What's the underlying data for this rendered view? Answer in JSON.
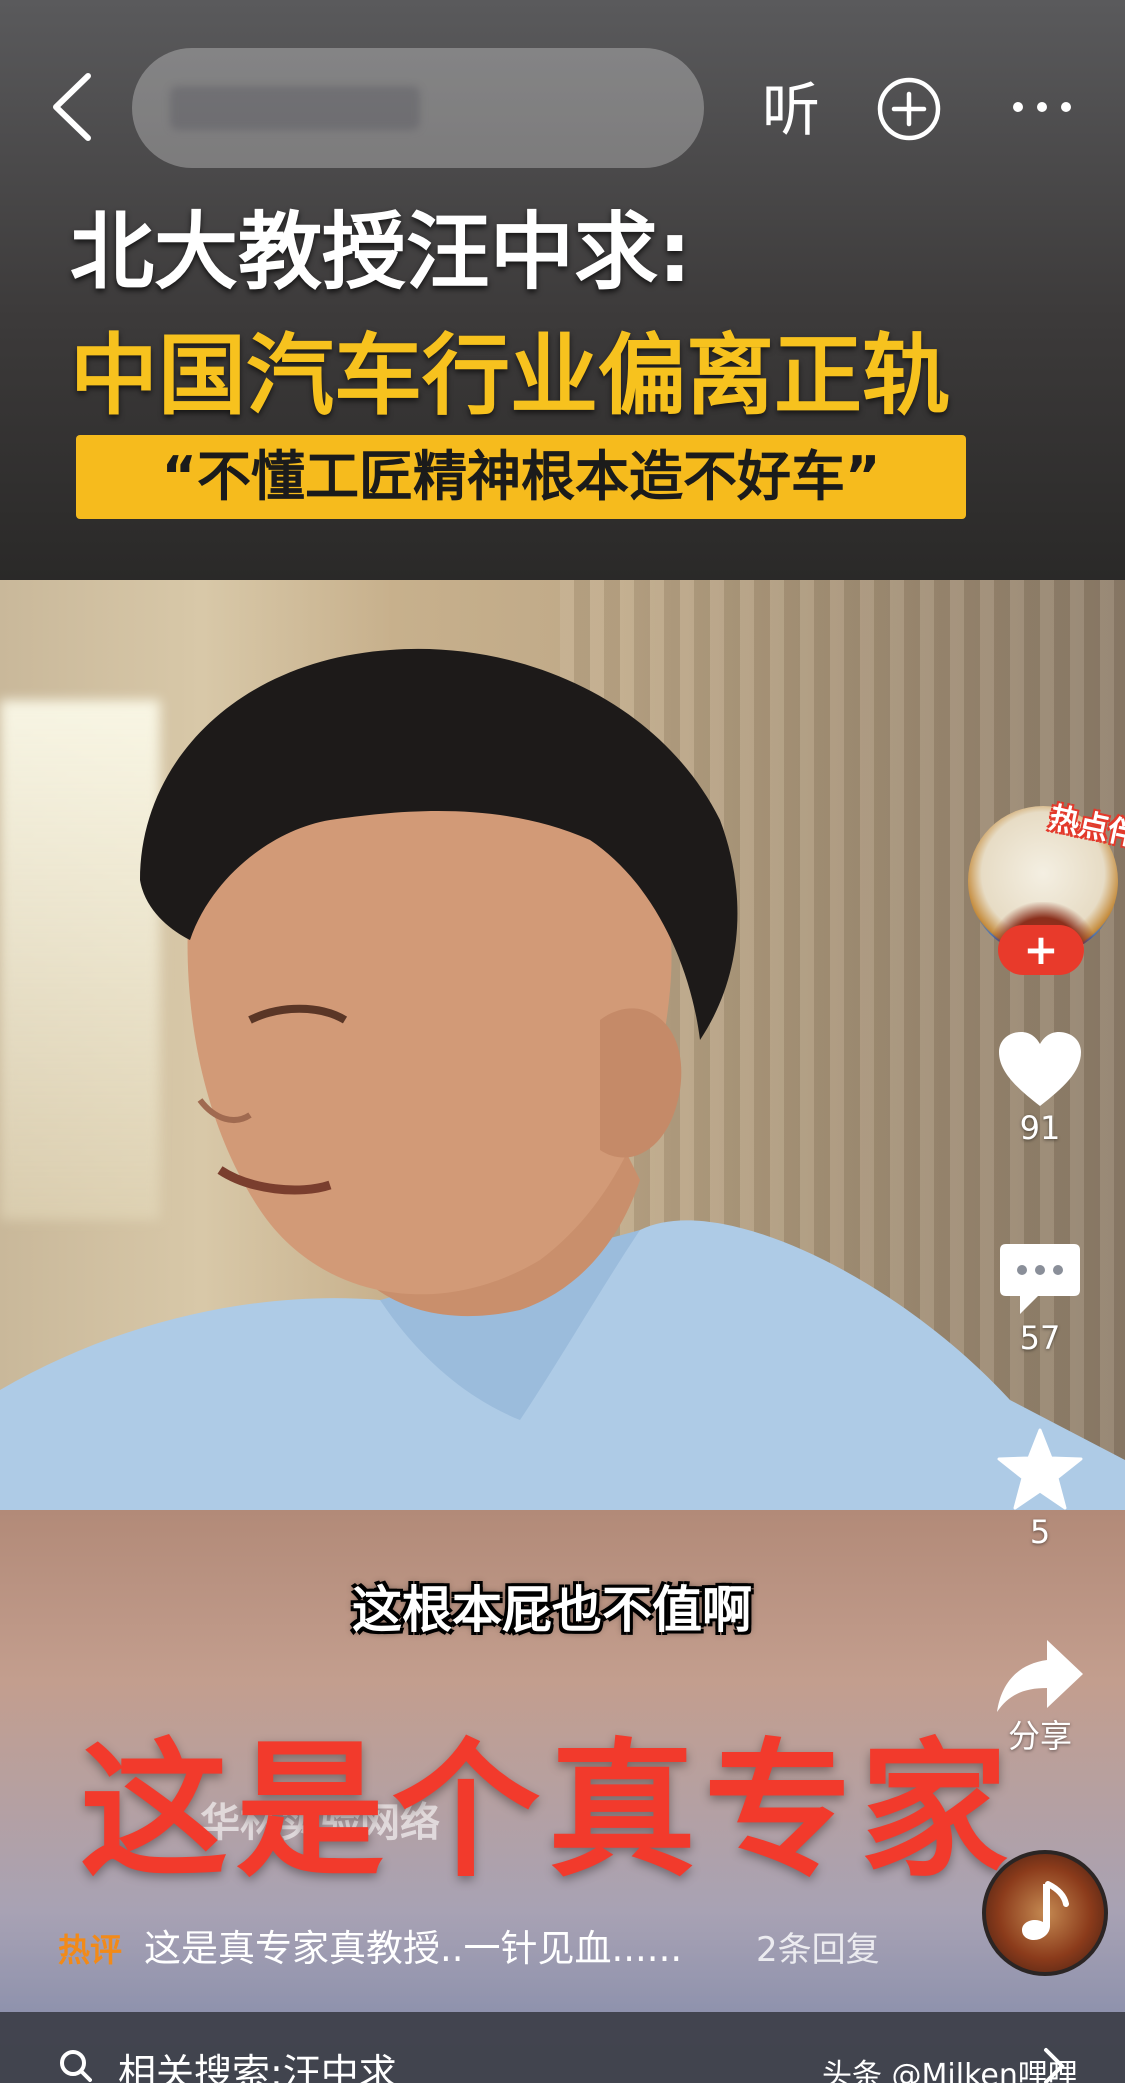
{
  "top_bar": {
    "listen_label": "听",
    "icons": {
      "back": "chevron-left-icon",
      "add": "plus-circle-icon",
      "more": "more-dots-icon"
    }
  },
  "video": {
    "title_line_1": "北大教授汪中求:",
    "title_line_2": "中国汽车行业偏离正轨",
    "subtitle_banner": "“不懂工匠精神根本造不好车”",
    "spoken_caption": "这根本屁也不值啊",
    "overlay_text": "这是个真专家",
    "watermark": "华林实验网络"
  },
  "sidebar": {
    "hot_badge": "热点伴",
    "follow_symbol": "+",
    "like_count": "91",
    "comment_count": "57",
    "favorite_count": "5",
    "share_label": "分享"
  },
  "hot_comment": {
    "label": "热评",
    "text": "这是真专家真教授..一针见血......",
    "reply_count": "2条回复"
  },
  "related": {
    "text": "相关搜索:汪中求",
    "source": "头条 @Milken哩哩"
  },
  "colors": {
    "title_yellow": "#f7c21e",
    "overlay_red": "#f23a2c",
    "hot_label_orange": "#f28a18",
    "follow_red": "#e83a2b"
  }
}
